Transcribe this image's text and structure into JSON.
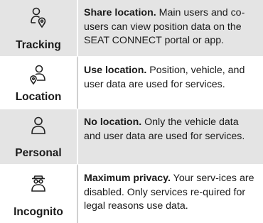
{
  "rows": [
    {
      "mode": "Tracking",
      "icon": "person-location-pin-icon",
      "title": "Share location.",
      "text": " Main users and co-users can view position data on the SEAT CONNECT portal or app."
    },
    {
      "mode": "Location",
      "icon": "person-map-pin-icon",
      "title": "Use location.",
      "text": " Position, vehicle, and user data are used for services."
    },
    {
      "mode": "Personal",
      "icon": "person-icon",
      "title": "No location.",
      "text": " Only the vehicle data and user data are used for services."
    },
    {
      "mode": "Incognito",
      "icon": "incognito-person-icon",
      "title": "Maximum privacy.",
      "text": " Your serv-ices are disabled. Only services re-quired for legal reasons use data."
    }
  ]
}
